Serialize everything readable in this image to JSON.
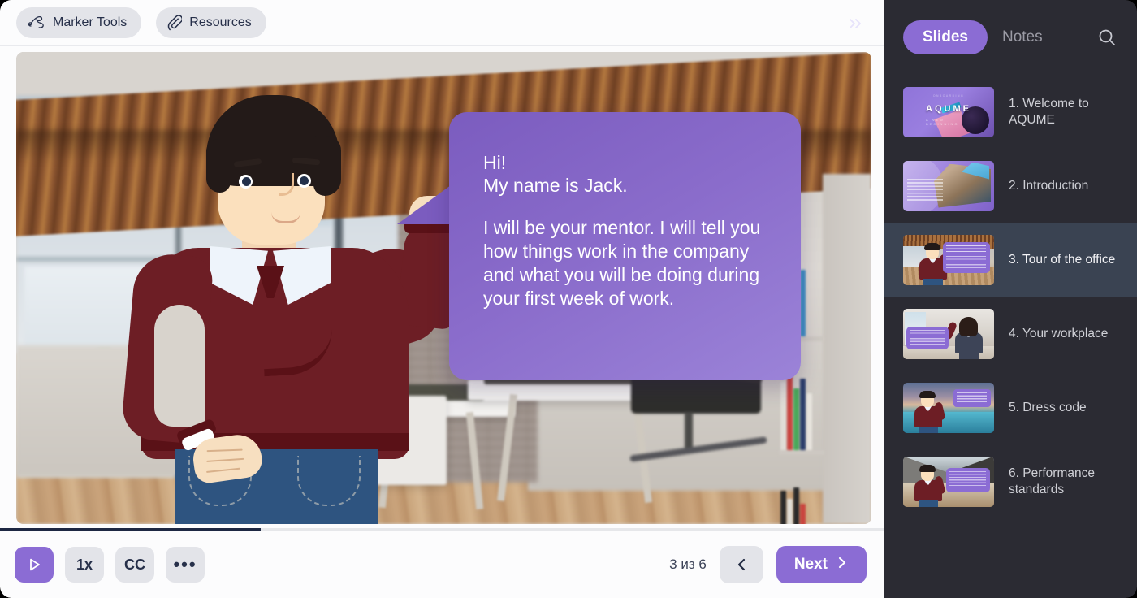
{
  "toolbar": {
    "marker_tools_label": "Marker Tools",
    "resources_label": "Resources",
    "collapse_icon": "double-chevron-right-icon"
  },
  "slide": {
    "bubble": {
      "greeting": "Hi!\nMy name is Jack.",
      "body": "I will be your mentor. I will tell you how things work in the company and what you will be doing during your first week of work."
    }
  },
  "controls": {
    "play_label": "▷",
    "speed_label": "1x",
    "captions_label": "CC",
    "more_label": "•••",
    "page_counter": "3 из 6",
    "prev_label": "‹",
    "next_label": "Next",
    "progress_percent": 29.5
  },
  "sidebar": {
    "tab_slides": "Slides",
    "tab_notes": "Notes",
    "search_icon": "search-icon",
    "slides": [
      {
        "number": "1.",
        "title": "Welcome to AQUME",
        "label": "1. Welcome to AQUME",
        "active": false
      },
      {
        "number": "2.",
        "title": "Introduction",
        "label": "2. Introduction",
        "active": false
      },
      {
        "number": "3.",
        "title": "Tour of the office",
        "label": "3. Tour of the office",
        "active": true
      },
      {
        "number": "4.",
        "title": "Your workplace",
        "label": "4. Your workplace",
        "active": false
      },
      {
        "number": "5.",
        "title": "Dress code",
        "label": "5. Dress code",
        "active": false
      },
      {
        "number": "6.",
        "title": "Performance standards",
        "label": "6. Performance standards",
        "active": false
      }
    ],
    "thumb1_logo": "AQUME"
  },
  "colors": {
    "accent_purple": "#8b6cd4",
    "bubble_purple": "#7b5cbf",
    "sidebar_bg": "#2b2b33",
    "sidebar_active": "#3a4352",
    "progress_fill": "#1d2742",
    "chip_gray": "#e3e4e9",
    "sweater_maroon": "#6d1e25"
  }
}
